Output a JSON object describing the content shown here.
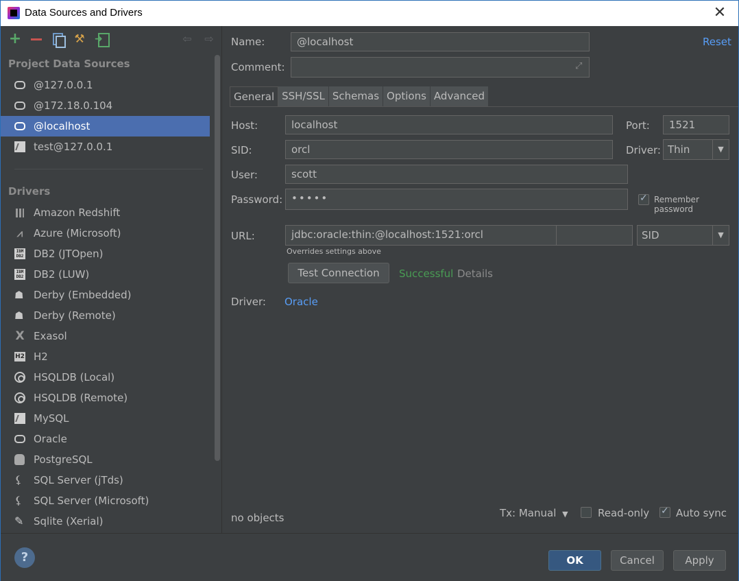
{
  "window": {
    "title": "Data Sources and Drivers",
    "close_glyph": "✕"
  },
  "toolbar": {
    "add": "+",
    "props": "⚒",
    "back": "⇦",
    "forward": "⇨"
  },
  "left": {
    "project_title": "Project Data Sources",
    "data_sources": [
      {
        "label": "@127.0.0.1",
        "icon": "oracle-icon"
      },
      {
        "label": "@172.18.0.104",
        "icon": "oracle-icon"
      },
      {
        "label": "@localhost",
        "icon": "oracle-icon"
      },
      {
        "label": "test@127.0.0.1",
        "icon": "mysql-icon"
      }
    ],
    "drivers_title": "Drivers",
    "drivers": [
      {
        "label": "Amazon Redshift",
        "icon": "redshift-icon"
      },
      {
        "label": "Azure (Microsoft)",
        "icon": "azure-icon"
      },
      {
        "label": "DB2 (JTOpen)",
        "icon": "ibm-icon",
        "icon_text": "IBM DB2"
      },
      {
        "label": "DB2 (LUW)",
        "icon": "ibm-icon",
        "icon_text": "IBM DB2"
      },
      {
        "label": "Derby (Embedded)",
        "icon": "derby-hat-icon"
      },
      {
        "label": "Derby (Remote)",
        "icon": "derby-hat-icon"
      },
      {
        "label": "Exasol",
        "icon": "exasol-icon"
      },
      {
        "label": "H2",
        "icon": "h2-icon",
        "icon_text": "H2"
      },
      {
        "label": "HSQLDB (Local)",
        "icon": "hsqldb-icon"
      },
      {
        "label": "HSQLDB (Remote)",
        "icon": "hsqldb-icon"
      },
      {
        "label": "MySQL",
        "icon": "mysql-icon"
      },
      {
        "label": "Oracle",
        "icon": "oracle-icon"
      },
      {
        "label": "PostgreSQL",
        "icon": "postgresql-icon"
      },
      {
        "label": "SQL Server (jTds)",
        "icon": "sqlserver-icon"
      },
      {
        "label": "SQL Server (Microsoft)",
        "icon": "sqlserver-icon"
      },
      {
        "label": "Sqlite (Xerial)",
        "icon": "sqlite-icon"
      }
    ]
  },
  "form": {
    "name_label": "Name:",
    "name_value": "@localhost",
    "reset_link": "Reset",
    "comment_label": "Comment:",
    "comment_value": "",
    "tabs": [
      "General",
      "SSH/SSL",
      "Schemas",
      "Options",
      "Advanced"
    ],
    "active_tab": "General",
    "host_label": "Host:",
    "host_value": "localhost",
    "port_label": "Port:",
    "port_value": "1521",
    "sid_label": "SID:",
    "sid_value": "orcl",
    "driver_label": "Driver:",
    "driver_value": "Thin",
    "user_label": "User:",
    "user_value": "scott",
    "password_label": "Password:",
    "password_value": "•••••",
    "remember_password": "Remember password",
    "remember_checked": true,
    "url_label": "URL:",
    "url_value": "jdbc:oracle:thin:@localhost:1521:orcl",
    "url_type": "SID",
    "url_hint": "Overrides settings above",
    "test_connection": "Test Connection",
    "status": "Successful",
    "details": "Details",
    "driver_link_label": "Driver:",
    "driver_link": "Oracle",
    "objects": "no objects",
    "tx": "Tx: Manual",
    "readonly": "Read-only",
    "readonly_checked": false,
    "autosync": "Auto sync",
    "autosync_checked": true
  },
  "footer": {
    "help": "?",
    "ok": "OK",
    "cancel": "Cancel",
    "apply": "Apply"
  },
  "colors": {
    "selection": "#4b6eaf",
    "link": "#589df6",
    "success": "#499c54",
    "add": "#59a869",
    "remove": "#c75450"
  }
}
